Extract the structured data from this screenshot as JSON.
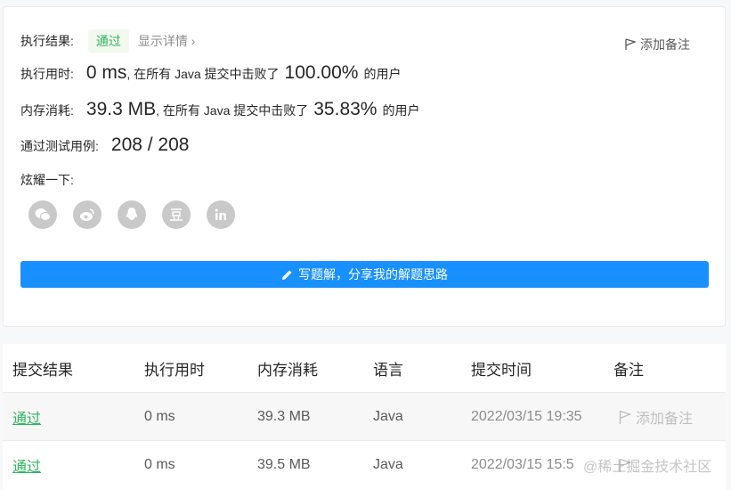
{
  "result": {
    "label": "执行结果:",
    "status": "通过",
    "detail_link": "显示详情 ›",
    "add_note": "添加备注"
  },
  "runtime": {
    "label": "执行用时:",
    "value": "0 ms",
    "beat_text": ", 在所有 Java 提交中击败了",
    "percent": "100.00%",
    "suffix": "的用户"
  },
  "memory": {
    "label": "内存消耗:",
    "value": "39.3 MB",
    "beat_text": ", 在所有 Java 提交中击败了",
    "percent": "35.83%",
    "suffix": "的用户"
  },
  "tests": {
    "label": "通过测试用例:",
    "value": "208 / 208"
  },
  "share": {
    "label": "炫耀一下:",
    "icons": [
      "wechat-icon",
      "weibo-icon",
      "qq-icon",
      "douban-icon",
      "linkedin-icon"
    ]
  },
  "solution_button": "写题解，分享我的解题思路",
  "table": {
    "headers": [
      "提交结果",
      "执行用时",
      "内存消耗",
      "语言",
      "提交时间",
      "备注"
    ],
    "rows": [
      {
        "status": "通过",
        "runtime": "0 ms",
        "memory": "39.3 MB",
        "lang": "Java",
        "time": "2022/03/15 19:35",
        "note": "添加备注"
      },
      {
        "status": "通过",
        "runtime": "0 ms",
        "memory": "39.5 MB",
        "lang": "Java",
        "time": "2022/03/15 15:5",
        "note": ""
      }
    ]
  },
  "watermark": "@稀土掘金技术社区",
  "colors": {
    "accent": "#1890ff",
    "success": "#2db55d",
    "icon_gray": "#c9c9c9"
  }
}
